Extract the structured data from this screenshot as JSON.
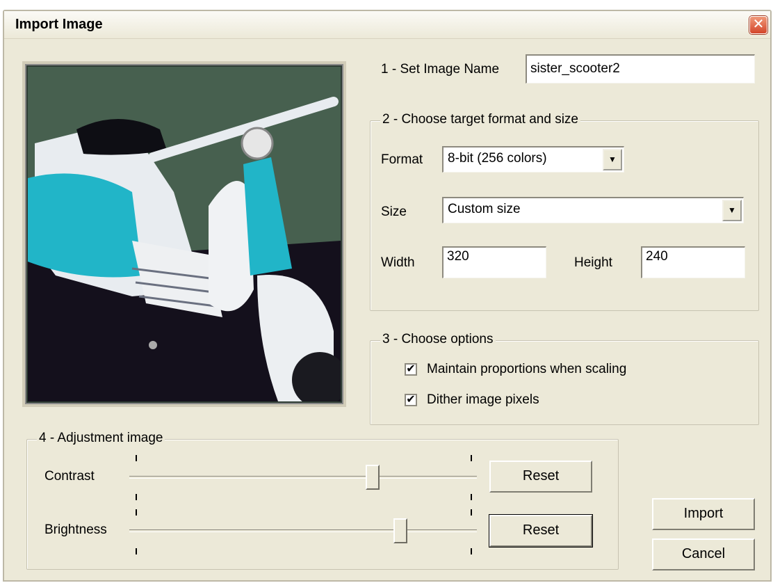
{
  "window": {
    "title": "Import Image",
    "close_symbol": "✕"
  },
  "step1": {
    "label": "1 - Set Image Name",
    "image_name": "sister_scooter2"
  },
  "step2": {
    "legend": "2 - Choose target format and size",
    "format_label": "Format",
    "format_value": "8-bit (256 colors)",
    "size_label": "Size",
    "size_value": "Custom size",
    "width_label": "Width",
    "width_value": "320",
    "height_label": "Height",
    "height_value": "240"
  },
  "step3": {
    "legend": "3 - Choose options",
    "maintain_proportions": {
      "label": "Maintain proportions when scaling",
      "checked": true
    },
    "dither": {
      "label": "Dither image pixels",
      "checked": true
    }
  },
  "step4": {
    "legend": "4 - Adjustment image",
    "contrast_label": "Contrast",
    "contrast_level": 0.7,
    "brightness_label": "Brightness",
    "brightness_level": 0.78,
    "reset_label": "Reset"
  },
  "actions": {
    "import_label": "Import",
    "cancel_label": "Cancel"
  },
  "icons": {
    "check": "✔",
    "dropdown": "▼"
  },
  "colors": {
    "dialog_bg": "#ece9d8",
    "close_red": "#d3452a",
    "scooter_teal": "#21b5c8"
  }
}
